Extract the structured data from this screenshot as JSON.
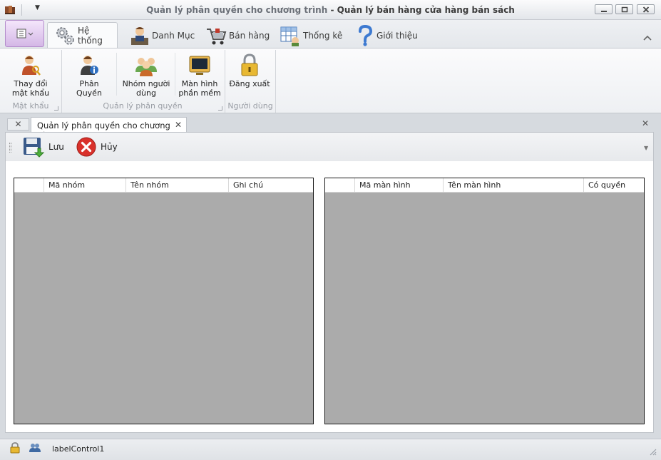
{
  "window": {
    "title_prefix": "Quản lý phân quyền cho chương trình",
    "title_separator": " - ",
    "title_main": "Quản lý bán hàng cửa hàng bán sách"
  },
  "ribbon": {
    "tabs": [
      {
        "label": "Hệ thống",
        "active": true
      },
      {
        "label": "Danh Mục"
      },
      {
        "label": "Bán hàng"
      },
      {
        "label": "Thống kê"
      },
      {
        "label": "Giới thiệu"
      }
    ],
    "groups": [
      {
        "label": "Mật khẩu",
        "items": [
          {
            "label_line1": "Thay đổi",
            "label_line2": "mật khẩu"
          }
        ]
      },
      {
        "label": "Quản lý phân quyền",
        "items": [
          {
            "label_line1": "Phân Quyền"
          },
          {
            "label_line1": "Nhóm người",
            "label_line2": "dùng"
          },
          {
            "label_line1": "Màn hình",
            "label_line2": "phần mềm"
          }
        ]
      },
      {
        "label": "Người dùng",
        "items": [
          {
            "label_line1": "Đăng xuất"
          }
        ]
      }
    ]
  },
  "document": {
    "tab_title": "Quản lý phân quyền cho chương trình",
    "close_glyph": "✕"
  },
  "toolbar": {
    "save_label": "Lưu",
    "cancel_label": "Hủy"
  },
  "grid_left": {
    "columns": [
      "Mã nhóm",
      "Tên nhóm",
      "Ghi chú"
    ],
    "rows": []
  },
  "grid_right": {
    "columns": [
      "Mã màn hình",
      "Tên màn hình",
      "Có quyền"
    ],
    "rows": []
  },
  "statusbar": {
    "label": "labelControl1"
  },
  "colors": {
    "grid_empty_bg": "#ababab",
    "app_menu_accent": "#d4b7e6"
  }
}
